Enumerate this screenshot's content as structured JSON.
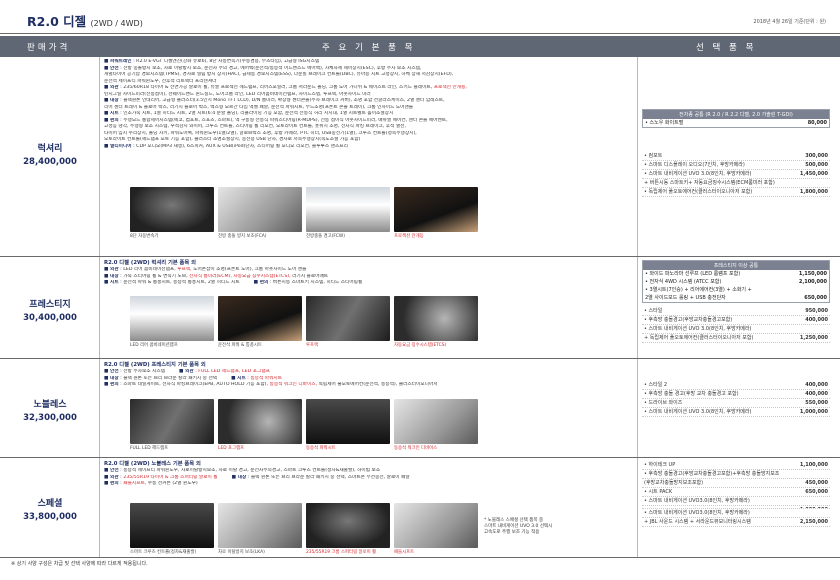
{
  "page": {
    "title": "R2.0 디젤",
    "title_sub": "(2WD / 4WD)",
    "date": "2018년 4월 26일 기준(단위 : 원)"
  },
  "table_header": {
    "price": "판매가격",
    "basic": "주 요 기 본 품 목",
    "option": "선 택 품 목"
  },
  "trims": [
    {
      "name": "럭셔리",
      "price": "28,400,000",
      "lines": [
        {
          "k": "■ 파워트레인",
          "t": " : R2.0 E-VGT 디젤엔진(강화 유로6), 8단 자동변속기(수동겸용, 부츠타입), 고급형 ISG시스템"
        },
        {
          "k": "■ 안전",
          "t": " : 전방 충돌방지 보조, 차로 이탈방지 보조, 운전자 주의 경고, 에어백(운전석/동승석 어드밴스드 에어백), 차체자세 제어장치(ESC), 후방 주차 보조 시스템,"
        },
        {
          "k": "",
          "t": "   개별타이어 공기압 경보시스템(TPMS), 경사로 밀림 방지 장치(HAC), 급제동 경보시스템(ESS), 다운힐 브레이크 컨트롤(DBC), 유아용 시트 고정장치, 하체 상해 저감장치(EFD),"
        },
        {
          "k": "",
          "t": "   운전석 세이프티 파워윈도우, 전후석 리트랙터 프리텐셔너"
        },
        {
          "k": "■ 외관",
          "t": " : 235/60R18 타이어 & 전면가공 알로이 휠, 듀얼 프로젝션 헤드램프, 리어스포일러, 크롬 서라운드 몰딩, 크롬 도어 가니쉬 & 웨이스트 라인, 스키드 플레이트, ",
          "red": "프로젝션 안개등,"
        },
        {
          "k": "",
          "t": "   턴시그널 사이드미러(전동접이), 선쉐이드밴드 윈드실드, 도어크롬 라인, LED 리어콤비네이션램프, 사이드스텝, 루프랙, 아웃사이드 미러"
        },
        {
          "k": "■ 내장",
          "t": " : 블랙원톤 인테리어, 고급형 클러스터(3.5인치 Mono TFT LCD), D/N 룸미러, 확장형 센터콘솔(주차 브레이크 커버), 조명 포함 선글라스케이스, 2열 센터 암레스트,"
        },
        {
          "k": "",
          "t": "   리어 센터 트레이 & 플로어 박스, 러기지 플로어 박스, 백스형 오르간 타입 액셀 페달, 운전석 파워시트, 무드조명(프론트 콘솔 트레이), 크롬 인사이드 도어핸들"
        },
        {
          "k": "■ 시트",
          "t": " : 인조가죽 시트, 1열 히티드 시트, 2열 시트(6:4 분할 폴딩), 리클라이닝 기능 포함, 운전석 전동식 허리 지지대, 1열 시트벨트 높이조절장치"
        },
        {
          "k": "■ 편의",
          "t": " : 주행모드 통합제어시스템(에코, 컴포트, 스포츠, 스마트), 액 구동형 전동식 파워스티어링(R-MDPS), 전동 접이식 아웃사이드미러, 매뉴얼 에어컨, 센터 콘솔 에어벤트,"
        },
        {
          "k": "",
          "t": "   고성능 냉각, 주행형 보조 시스템, 우적감지 와이퍼, 크루즈 컨트롤, 스티어링 휠 리모컨, 오토라이트 컨트롤, 풋위치 조명, 전자식 파킹 브레이크, 후석 열선,"
        },
        {
          "k": "",
          "t": "   타이어 임시 수리장치, 폴딩 차키, 파워도어록, 파워윈도우(1열/2열), 글로브박스 조명, 후방 카메라, PTC 히터, USB충전기(1열), 크루즈 컨트롤(정속주행장치),"
        },
        {
          "k": "",
          "t": "   오토라이트 컨트롤(헤드램프 오토 기능 포함), 클러스터 조명조절장치, 충전용 USB 단자, 경사로 저속주행장치(속도조절 가능 포함)"
        },
        {
          "k": "■ 멀티미디어",
          "t": " : CDP 오디오(MP3 재생), 6스피커, AUX & USB(iPod)단자, 스티어링 휠 오디오 리모컨, 블루투스 핸즈프리"
        }
      ],
      "thumbs": [
        {
          "cap": "8단 자동변속기",
          "red": false
        },
        {
          "cap": "전방 충돌 방지 보조(FCA)",
          "red": false
        },
        {
          "cap": "전방충돌 경고(FCW)",
          "red": false
        },
        {
          "cap": "프로젝션 안개등",
          "red": true
        }
      ],
      "box": {
        "head": "전차종 공통 (R 2.0 / R 2.2 디젤, 2.0 가솔린 T-GDI)",
        "items": [
          {
            "n": "• 스노우 화이트펄",
            "p": "80,000"
          }
        ]
      },
      "opts": [
        {
          "n": "• 컴포트",
          "p": "300,000"
        },
        {
          "n": "• 스마트 디스플레이 오디오(7인치, 후방카메라)",
          "p": "500,000"
        },
        {
          "n": "• 스마트 내비게이션 UVO 3.0(8인치, 후방카메라)",
          "p": "1,450,000"
        },
        {
          "n": "  + 버튼시동 스마트키+ 자동요금징수시스템(ECM룸미러 포함)",
          "p": ""
        },
        {
          "n": "• 독립제어 풀오토에어컨(클러스터이오니아저 포함)",
          "p": "1,800,000"
        }
      ]
    },
    {
      "name": "프레스티지",
      "price": "30,400,000",
      "headline": "R2.0 디젤 (2WD) 럭셔리 기본 품목 외",
      "lines": [
        {
          "k": "■ 외관",
          "t": " : LED 리어 콤비네이션램프, ",
          "red": "루프랙,",
          "t2": " 도어손잡이 조명(프론트 도어), 크롬 아웃사이드 도어 핸들"
        },
        {
          "k": "■ 내장",
          "t": " : 가죽 스티어링 휠 & 변속기 노브, ",
          "red": "전자식 룸미러(ECM), 자동요금 징수시스템(ETCS),",
          "t2": " 러기지 플로어매트"
        },
        {
          "k": "■ 시트",
          "t": " : 운전석 파워 & 통풍시트, 동승석 통풍시트, 2열 히티드 시트",
          "k2": "■ 편의",
          "t3": " : 버튼시동 스마트키 시스템, 히티드 스티어링휠"
        }
      ],
      "thumbs": [
        {
          "cap": "LED 리어 콤비네이션램프",
          "red": false
        },
        {
          "cap": "운전석 파워 & 통풍시트",
          "red": false
        },
        {
          "cap": "루프랙",
          "red": true
        },
        {
          "cap": "자동요금 징수시스템(ETCS)",
          "red": true
        }
      ],
      "box": {
        "head": "프레스티지 이상 공통",
        "items": [
          {
            "n": "• 와이드 파노라마 선루프 (LED 룸램프 포함)",
            "p": "1,150,000"
          },
          {
            "n": "• 전자식 4WD 시스템 (ATCC 포함)",
            "p": "2,100,000"
          },
          {
            "n": "• 3열시트(7인승) + 리어에어컨(3열) + 소화기 +",
            "p": ""
          },
          {
            "n": "  2열 사이드모드 롤링 + USB 충전단자",
            "p": "650,000"
          }
        ]
      },
      "opts": [
        {
          "n": "• 스타일",
          "p": "950,000"
        },
        {
          "n": "• 후측방 충돌경고(후방교차충돌경고포함)",
          "p": "400,000"
        },
        {
          "n": "• 스마트 내비게이션 UVO 3.0(8인치, 후방카메라)",
          "p": ""
        },
        {
          "n": "  + 독립제어 풀오토에어컨(클러스터이오니아저 포함)",
          "p": "1,250,000"
        }
      ]
    },
    {
      "name": "노블레스",
      "price": "32,300,000",
      "headline": "R2.0 디젤 (2WD) 프레스티지 기본 품목 외",
      "lines": [
        {
          "k": "■ 안전",
          "t": " : 전방 주차보조 시스템",
          "k2": "■ 외관",
          "t3": " : FULL LED 헤드램프, LED 포그램프",
          "red2": true
        },
        {
          "k": "■ 내장",
          "t": " : 블랙 원톤 또는 브리 브라운 칼라 패키지 중 선택",
          "k2": "■ 시트",
          "t3": " : 동승석 파워시트",
          "red2": true
        },
        {
          "k": "■ 편의",
          "t": " : 스마트 테일게이트, 전자식 파킹브레이크(EPB, AUTO HOLD 기능 포함), ",
          "red": "동승석 워크인 디바이스,",
          "t2": " 독립제어 풀오토에어컨(운전석, 동승석), 클러스터이오니아저"
        }
      ],
      "thumbs": [
        {
          "cap": "FULL LED 헤드램프",
          "red": false
        },
        {
          "cap": "LED 포그램프",
          "red": true
        },
        {
          "cap": "동승석 파워시트",
          "red": true
        },
        {
          "cap": "동승석 워크인 디바이스",
          "red": true
        }
      ],
      "opts": [
        {
          "n": "• 스타일 2",
          "p": "400,000"
        },
        {
          "n": "• 후측방 충돌 경고(후방 교차 충돌경고 포함)",
          "p": "400,000"
        },
        {
          "n": "• 드라이브 와이즈",
          "p": "550,000"
        },
        {
          "n": "• 스마트 내비게이션 UVO 3.0(8인치, 후방카메라)",
          "p": "1,000,000"
        }
      ]
    },
    {
      "name": "스페셜",
      "price": "33,800,000",
      "headline": "R2.0 디젤 (2WD) 노블레스 기본 품목 외",
      "lines": [
        {
          "k": "■ 안전",
          "t": " : 동승석 세이프티 파워윈도우, 차로이탈방지보조, 차로 이탈 경고, 운전자주의경고, 스마트 크루즈 컨트롤(정차&재출발), 하이빔 보조"
        },
        {
          "k": "■ 외관",
          "t": " : ",
          "red": "235/55R19 타이어 & 크롬 스퍼터링 알로이 휠",
          "k2": "■ 내장",
          "t3": " : 블랙 원톤 또는 브리 브라운 칼라 패키지 중 선택, 스마트폰 무선충전, 알로이 페달"
        },
        {
          "k": "■ 편의",
          "t": " : ",
          "red": "패들시프트,",
          "t2": " 수동 선커튼 (2열 윈도우)"
        }
      ],
      "thumbs": [
        {
          "cap": "스마트 크루즈 컨트롤(정차&재출발)",
          "red": false
        },
        {
          "cap": "차로 이탈방지 보조(LKA)",
          "red": false
        },
        {
          "cap": "235/55R19 크롬 스퍼터링 알로이 휠",
          "red": true
        },
        {
          "cap": "패들시프트",
          "red": true
        }
      ],
      "note": [
        "* 노블레스 스페셜 선택 품목 중",
        "스마트 내비게이션 UVO 3.0 선택시",
        "고속도로 주행 보조 기능 적용"
      ],
      "opts": [
        {
          "n": "• 하이테크 UP",
          "p": "1,100,000"
        },
        {
          "n": "• 후측방 충돌경고(후방교차충돌경고포함)+후측방 충돌방지보조",
          "p": ""
        },
        {
          "n": "  (후방교차충돌방지보조포함)",
          "p": "450,000"
        },
        {
          "n": "• 시트 PACK",
          "p": "650,000"
        },
        {
          "n": "• 스마트 내비게이션 UVO3.0(8인치, 후방카메라)",
          "p": ""
        },
        {
          "n": "",
          "p": "1,000,000"
        },
        {
          "n": "• 스마트 내비게이션 UVO3.0(8인치, 후방카메라)",
          "p": ""
        },
        {
          "n": "  + JBL 사운드 시스템 + 서라운드뷰모니터링시스템",
          "p": "2,150,000"
        }
      ]
    }
  ],
  "footer": "※ 상기 사양 구성은 차급 및 선택 사양에 따라 다르게 적용됩니다."
}
